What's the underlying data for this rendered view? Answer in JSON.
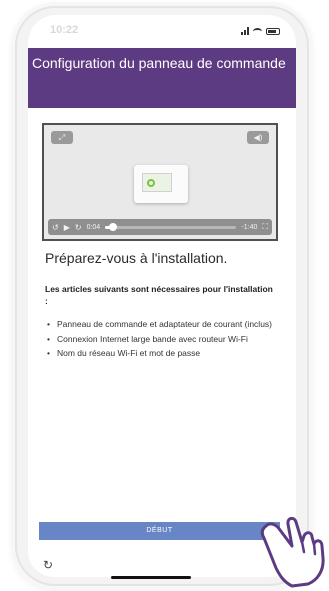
{
  "status_bar": {
    "time": "10:22"
  },
  "header": {
    "title": "Configuration du panneau de commande"
  },
  "video": {
    "expand_icon": "expand-icon",
    "mute_icon": "volume-mute-icon",
    "controls": {
      "replay_icon": "rewind-icon",
      "play_icon": "play-icon",
      "forward_icon": "forward-icon",
      "elapsed": "0:04",
      "remaining": "-1:40",
      "fullscreen_icon": "fullscreen-icon",
      "progress": 0.05
    }
  },
  "content": {
    "heading": "Préparez-vous à l'installation.",
    "intro": "Les articles suivants sont nécessaires pour l'installation :",
    "items": [
      "Panneau de commande et adaptateur de courant (inclus)",
      "Connexion Internet large bande avec routeur Wi-Fi",
      "Nom du réseau Wi-Fi et mot de passe"
    ]
  },
  "footer": {
    "start_button": "DÉBUT",
    "refresh_icon": "refresh-icon"
  },
  "colors": {
    "header_bg": "#5d3b83",
    "button_bg": "#6886c5"
  }
}
